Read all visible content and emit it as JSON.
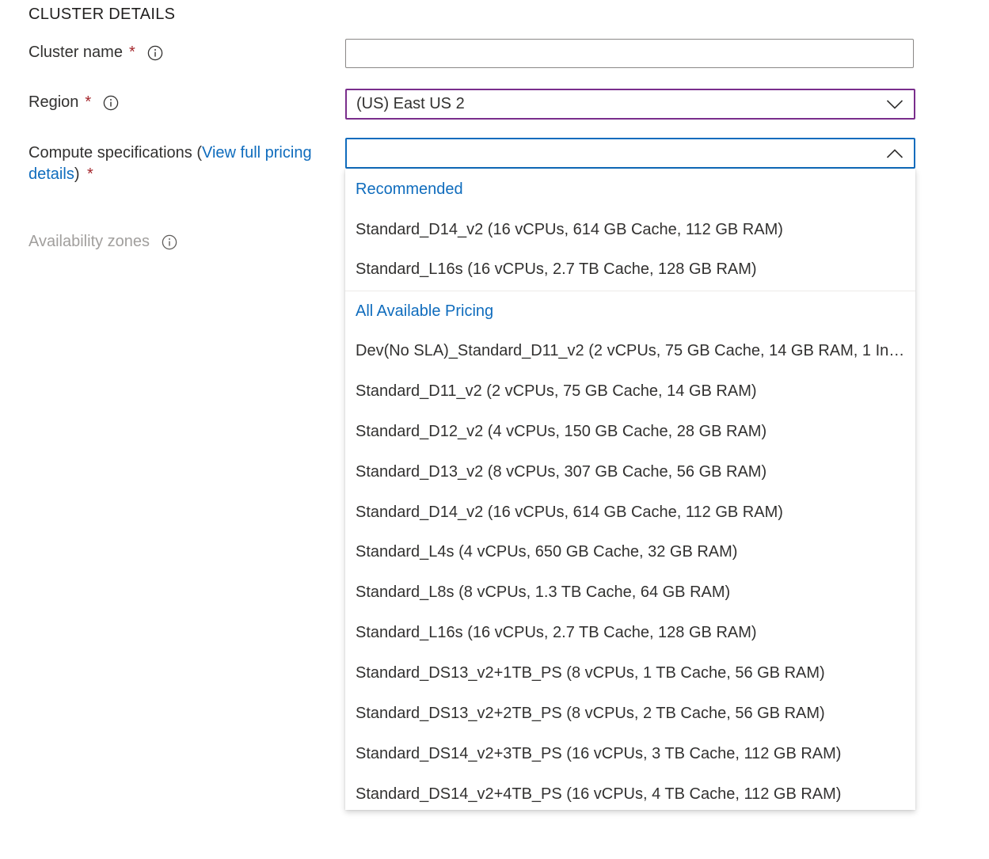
{
  "section": {
    "title": "CLUSTER DETAILS"
  },
  "cluster_name": {
    "label": "Cluster name",
    "required_mark": "*",
    "value": "",
    "placeholder": ""
  },
  "region": {
    "label": "Region",
    "required_mark": "*",
    "selected": "(US) East US 2"
  },
  "compute": {
    "label_prefix": "Compute specifications (",
    "link_text_1": "View full pricing",
    "link_text_2": "details",
    "label_suffix": ")",
    "required_mark": "*",
    "selected": ""
  },
  "availability_zones": {
    "label": "Availability zones"
  },
  "dropdown": {
    "groups": [
      {
        "header": "Recommended",
        "options": [
          "Standard_D14_v2 (16 vCPUs, 614 GB Cache, 112 GB RAM)",
          "Standard_L16s (16 vCPUs, 2.7 TB Cache, 128 GB RAM)"
        ]
      },
      {
        "header": "All Available Pricing",
        "options": [
          "Dev(No SLA)_Standard_D11_v2 (2 vCPUs, 75 GB Cache, 14 GB RAM, 1 Insta...",
          "Standard_D11_v2 (2 vCPUs, 75 GB Cache, 14 GB RAM)",
          "Standard_D12_v2 (4 vCPUs, 150 GB Cache, 28 GB RAM)",
          "Standard_D13_v2 (8 vCPUs, 307 GB Cache, 56 GB RAM)",
          "Standard_D14_v2 (16 vCPUs, 614 GB Cache, 112 GB RAM)",
          "Standard_L4s (4 vCPUs, 650 GB Cache, 32 GB RAM)",
          "Standard_L8s (8 vCPUs, 1.3 TB Cache, 64 GB RAM)",
          "Standard_L16s (16 vCPUs, 2.7 TB Cache, 128 GB RAM)",
          "Standard_DS13_v2+1TB_PS (8 vCPUs, 1 TB Cache, 56 GB RAM)",
          "Standard_DS13_v2+2TB_PS (8 vCPUs, 2 TB Cache, 56 GB RAM)",
          "Standard_DS14_v2+3TB_PS (16 vCPUs, 3 TB Cache, 112 GB RAM)",
          "Standard_DS14_v2+4TB_PS (16 vCPUs, 4 TB Cache, 112 GB RAM)"
        ]
      }
    ]
  },
  "colors": {
    "required": "#a4262c",
    "link": "#0f6cbd",
    "region_border": "#7a2e8c",
    "focus_border": "#0f6cbd",
    "disabled_text": "#a19f9d"
  }
}
